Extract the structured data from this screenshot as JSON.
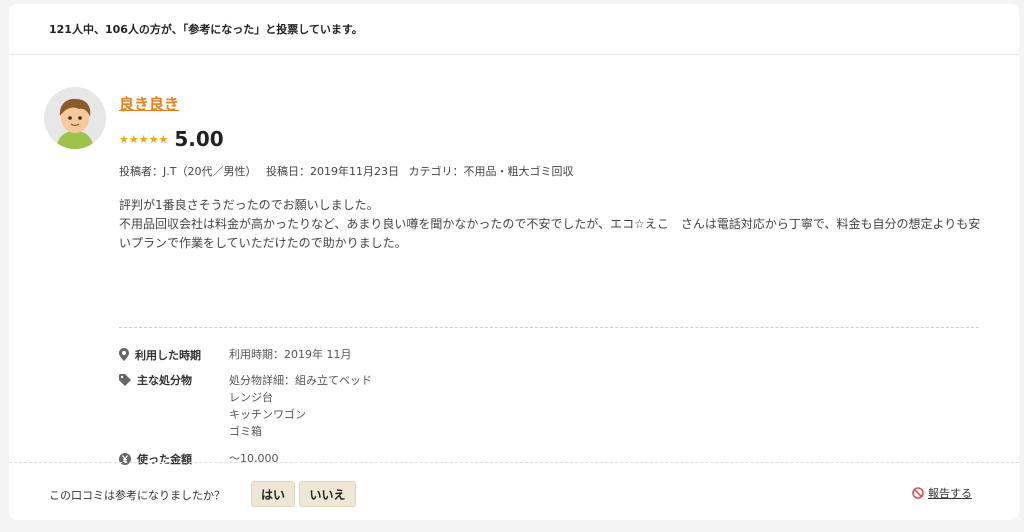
{
  "header": {
    "vote_summary": "121人中、106人の方が、「参考になった」と投票しています。"
  },
  "review": {
    "title": "良き良き",
    "stars": "★★★★★",
    "score": "5.00",
    "meta": {
      "author": "投稿者：J.T（20代／男性）",
      "date": "投稿日：2019年11月23日",
      "category": "カテゴリ：不用品・粗大ゴミ回収"
    },
    "body": [
      "評判が1番良さそうだったのでお願いしました。",
      "不用品回収会社は料金が高かったりなど、あまり良い噂を聞かなかったので不安でしたが、エコ☆えこ　さんは電話対応から丁寧で、料金も自分の想定よりも安いプランで作業をしていただけたので助かりました。"
    ],
    "details": {
      "period_label": "利用した時期",
      "period_value": "利用時期：2019年 11月",
      "items_label": "主な処分物",
      "items_values": [
        "処分物詳細：組み立てベッド",
        "レンジ台",
        "キッチンワゴン",
        "ゴミ箱"
      ],
      "amount_label": "使った金額",
      "amount_value": "〜10,000"
    }
  },
  "footer": {
    "question": "この口コミは参考になりましたか？",
    "yes_label": "はい",
    "no_label": "いいえ",
    "report_label": "報告する"
  },
  "colors": {
    "accent": "#e8801c",
    "star": "#f0a800",
    "button_bg": "#efe7d6",
    "report_icon": "#d9534f"
  }
}
